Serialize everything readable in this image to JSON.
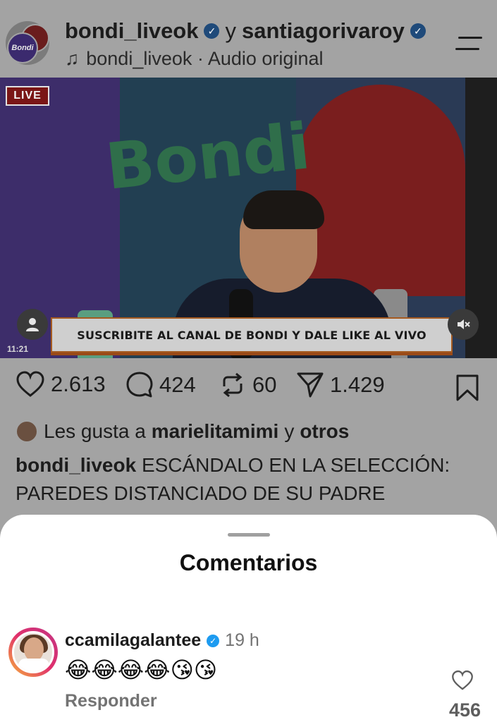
{
  "post": {
    "author": "bondi_liveok",
    "conjunction": "y",
    "collaborator": "santiagorivaroy",
    "audio": "bondi_liveok · Audio original",
    "avatar_label": "Bondi",
    "video": {
      "badge": "LIVE",
      "brand_text": "Bondi",
      "banner_text": "SUSCRIBITE AL CANAL DE BONDI Y DALE LIKE AL VIVO",
      "timestamp": "11:21"
    },
    "actions": {
      "likes": "2.613",
      "comments": "424",
      "reposts": "60",
      "shares": "1.429"
    },
    "liked_by": {
      "prefix": "Les gusta a",
      "user": "marielitamimi",
      "connector": "y",
      "others": "otros"
    },
    "caption": {
      "author": "bondi_liveok",
      "text": "ESCÁNDALO EN LA SELECCIÓN: PAREDES DISTANCIADO DE SU PADRE"
    }
  },
  "comments_sheet": {
    "title": "Comentarios",
    "comments": [
      {
        "username": "ccamilagalantee",
        "time": "19 h",
        "text": "😂😂😂😂😘😘",
        "reply_label": "Responder",
        "like_count": "456"
      }
    ]
  },
  "colors": {
    "backdrop": "#a3a3a3",
    "sheet": "#ffffff",
    "verified": "#1d9bf0",
    "secondary_text": "#737373"
  }
}
